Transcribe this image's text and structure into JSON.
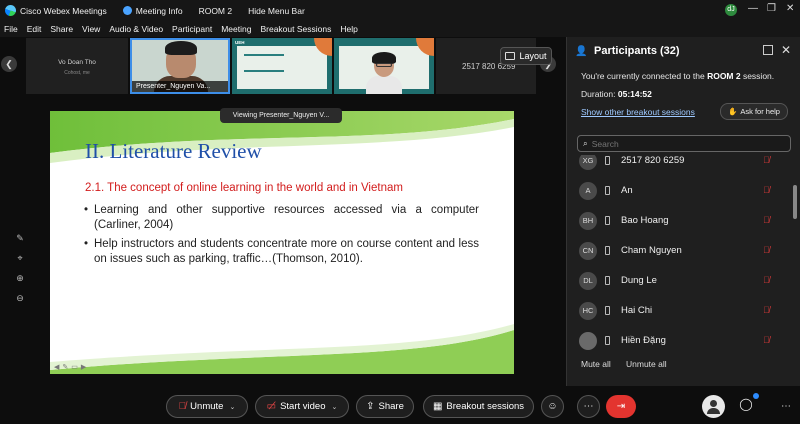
{
  "titlebar": {
    "app_name": "Cisco Webex Meetings",
    "meeting_info": "Meeting Info",
    "room": "ROOM 2",
    "hide_menu": "Hide Menu Bar",
    "status_initials": "dJ"
  },
  "menu": [
    "File",
    "Edit",
    "Share",
    "View",
    "Audio & Video",
    "Participant",
    "Meeting",
    "Breakout Sessions",
    "Help"
  ],
  "strip": {
    "tiles": [
      {
        "name": "Vo Doan Tho",
        "sub": "Cohost, me"
      },
      {
        "name": "Presenter_Nguyen Va..."
      },
      {
        "name": ""
      },
      {
        "name": ""
      },
      {
        "name": "2517 820 6259"
      }
    ],
    "layout_label": "Layout"
  },
  "viewing_banner": "Viewing Presenter_Nguyen V...",
  "slide": {
    "title": "II.  Literature Review",
    "subtitle": "2.1. The concept of online learning in the world and in Vietnam",
    "bullets": [
      "Learning and other supportive resources accessed via a computer (Carliner, 2004)",
      "Help instructors and students concentrate more on course content and less on issues such as parking, traffic…(Thomson, 2010)."
    ],
    "thumb_title": "UEH"
  },
  "panel": {
    "title": "Participants (32)",
    "connected_prefix": "You're currently connected to the ",
    "connected_room": "ROOM 2",
    "connected_suffix": " session.",
    "duration_label": "Duration: ",
    "duration_value": "05:14:52",
    "show_other": "Show other breakout sessions",
    "ask_help": "Ask for help",
    "search_placeholder": "Search",
    "participants": [
      {
        "initials": "XG",
        "name": "2517 820 6259"
      },
      {
        "initials": "A",
        "name": "An"
      },
      {
        "initials": "BH",
        "name": "Bao Hoang"
      },
      {
        "initials": "CN",
        "name": "Cham Nguyen"
      },
      {
        "initials": "DL",
        "name": "Dung Le"
      },
      {
        "initials": "HC",
        "name": "Hai Chi"
      },
      {
        "initials": "",
        "name": "Hiền Đặng"
      }
    ],
    "mute_all": "Mute all",
    "unmute_all": "Unmute all"
  },
  "controls": {
    "unmute": "Unmute",
    "start_video": "Start video",
    "share": "Share",
    "breakout": "Breakout sessions"
  },
  "colors": {
    "accent_blue": "#3d8ee8",
    "end_red": "#e3342f",
    "slide_title_blue": "#1f4fa8",
    "slide_subtitle_red": "#d21c1c"
  }
}
